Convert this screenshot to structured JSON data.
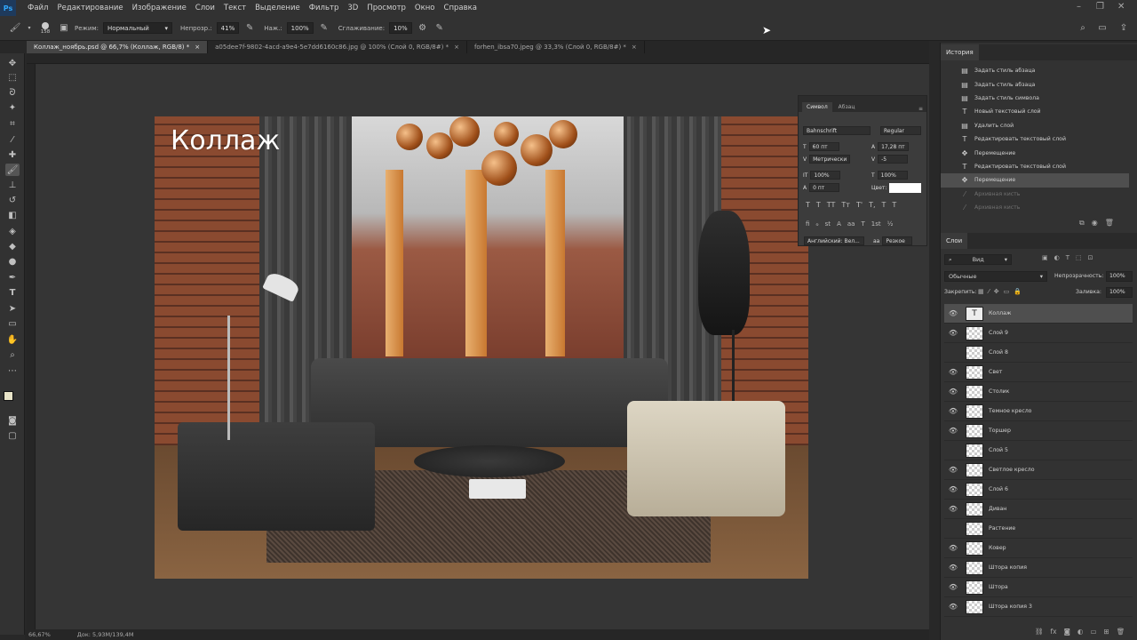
{
  "menu": [
    "Файл",
    "Редактирование",
    "Изображение",
    "Слои",
    "Текст",
    "Выделение",
    "Фильтр",
    "3D",
    "Просмотр",
    "Окно",
    "Справка"
  ],
  "app_logo": "Ps",
  "options": {
    "size_value": "158",
    "mode_label": "Режим:",
    "mode_value": "Нормальный",
    "opacity_label": "Непрозр.:",
    "opacity_value": "41%",
    "pressure_label": "Наж.:",
    "pressure_value": "100%",
    "smoothing_label": "Сглаживание:",
    "smoothing_value": "10%"
  },
  "tabs": [
    {
      "label": "Коллаж_ноябрь.psd @ 66,7% (Коллаж, RGB/8) *",
      "active": true
    },
    {
      "label": "a05dee7f-9802-4acd-a9e4-5e7dd6160c86.jpg @ 100% (Слой 0, RGB/8#) *",
      "active": false
    },
    {
      "label": "forhen_ibsa70.jpeg @ 33,3% (Слой 0, RGB/8#) *",
      "active": false
    }
  ],
  "canvas": {
    "collage_title": "Коллаж"
  },
  "status": {
    "zoom": "66,67%",
    "doc": "Док: 5,93M/139,4M"
  },
  "character_panel": {
    "tabs": [
      "Символ",
      "Абзац"
    ],
    "font_family": "Bahnschrift",
    "font_style": "Regular",
    "font_size": "60 пт",
    "leading": "17,28 пт",
    "kerning": "Метрически",
    "tracking": "-5",
    "vscale": "100%",
    "hscale": "100%",
    "baseline": "0 пт",
    "color_label": "Цвет:",
    "language": "Английский: Вел...",
    "aa_label": "aa",
    "antialias": "Резкое"
  },
  "history": {
    "title": "История",
    "items": [
      {
        "icon": "doc",
        "label": "Задать стиль абзаца",
        "state": "normal"
      },
      {
        "icon": "doc",
        "label": "Задать стиль абзаца",
        "state": "normal"
      },
      {
        "icon": "doc",
        "label": "Задать стиль символа",
        "state": "normal"
      },
      {
        "icon": "T",
        "label": "Новый текстовый слой",
        "state": "normal"
      },
      {
        "icon": "doc",
        "label": "Удалить слой",
        "state": "normal"
      },
      {
        "icon": "T",
        "label": "Редактировать текстовый слой",
        "state": "normal"
      },
      {
        "icon": "move",
        "label": "Перемещение",
        "state": "normal"
      },
      {
        "icon": "T",
        "label": "Редактировать текстовый слой",
        "state": "normal"
      },
      {
        "icon": "move",
        "label": "Перемещение",
        "state": "selected"
      },
      {
        "icon": "brush",
        "label": "Архивная кисть",
        "state": "dim"
      },
      {
        "icon": "brush",
        "label": "Архивная кисть",
        "state": "dim"
      }
    ]
  },
  "layers": {
    "title": "Слои",
    "filter": "Вид",
    "blend_mode": "Обычные",
    "opacity_label": "Непрозрачность:",
    "opacity_value": "100%",
    "lock_label": "Закрепить:",
    "fill_label": "Заливка:",
    "fill_value": "100%",
    "items": [
      {
        "name": "Коллаж",
        "visible": true,
        "type": "text",
        "selected": true
      },
      {
        "name": "Слой 9",
        "visible": true,
        "type": "image",
        "selected": false
      },
      {
        "name": "Слой 8",
        "visible": false,
        "type": "image",
        "selected": false
      },
      {
        "name": "Свет",
        "visible": true,
        "type": "image",
        "selected": false
      },
      {
        "name": "Столик",
        "visible": true,
        "type": "image",
        "selected": false
      },
      {
        "name": "Темное кресло",
        "visible": true,
        "type": "image",
        "selected": false
      },
      {
        "name": "Торшер",
        "visible": true,
        "type": "image",
        "selected": false
      },
      {
        "name": "Слой 5",
        "visible": false,
        "type": "image",
        "selected": false
      },
      {
        "name": "Светлое кресло",
        "visible": true,
        "type": "image",
        "selected": false
      },
      {
        "name": "Слой 6",
        "visible": true,
        "type": "image",
        "selected": false
      },
      {
        "name": "Диван",
        "visible": true,
        "type": "image",
        "selected": false
      },
      {
        "name": "Растение",
        "visible": false,
        "type": "image",
        "selected": false
      },
      {
        "name": "Ковер",
        "visible": true,
        "type": "image",
        "selected": false
      },
      {
        "name": "Штора копия",
        "visible": true,
        "type": "image",
        "selected": false
      },
      {
        "name": "Штора",
        "visible": true,
        "type": "image",
        "selected": false
      },
      {
        "name": "Штора копия 3",
        "visible": true,
        "type": "image",
        "selected": false
      }
    ]
  }
}
